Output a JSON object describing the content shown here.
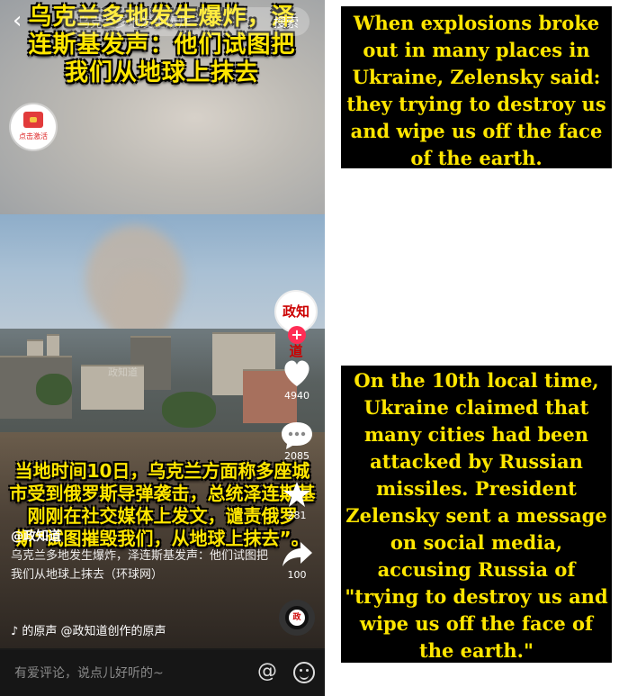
{
  "topbar": {
    "search_hint": "乌克兰多地发生爆炸",
    "search_button": "搜索"
  },
  "overlay": {
    "headline": "乌克兰多地发生爆炸，泽连斯基发声：他们试图把我们从地球上抹去",
    "body_cn": "当地时间10日，乌克兰方面称多座城市受到俄罗斯导弹袭击，总统泽连斯基刚刚在社交媒体上发文，谴责俄罗斯“试图摧毁我们，从地球上抹去”。",
    "watermark": "政知道"
  },
  "activate_badge": {
    "label": "点击激活"
  },
  "account": {
    "avatar_text": "政知道",
    "follow": "+"
  },
  "actions": {
    "likes": "4940",
    "comments": "2085",
    "favorites": "281",
    "shares": "100"
  },
  "caption": {
    "author": "@政知道",
    "description": "乌克兰多地发生爆炸，泽连斯基发声：他们试图把我们从地球上抹去（环球网）"
  },
  "music": {
    "text": "♪ 的原声 @政知道创作的原声"
  },
  "disc": {
    "label": "政"
  },
  "comment_bar": {
    "placeholder": "有爱评论，说点儿好听的~",
    "at": "@"
  },
  "translations": {
    "box1": "When explosions broke out in many places in Ukraine, Zelensky said: they trying to destroy us and wipe us off the face of the earth.",
    "box2": "On the 10th local time, Ukraine claimed that many cities had been attacked by Russian missiles. President Zelensky sent a message on social media, accusing Russia of \"trying to destroy us and wipe us off the face of the earth.\""
  },
  "colors": {
    "caption_yellow": "#ffe600",
    "follow_red": "#ff2d55",
    "translation_bg": "#000000"
  },
  "icons": [
    "back-icon",
    "heart-icon",
    "comment-icon",
    "star-icon",
    "share-icon",
    "music-note-icon",
    "at-icon",
    "emoji-icon"
  ]
}
